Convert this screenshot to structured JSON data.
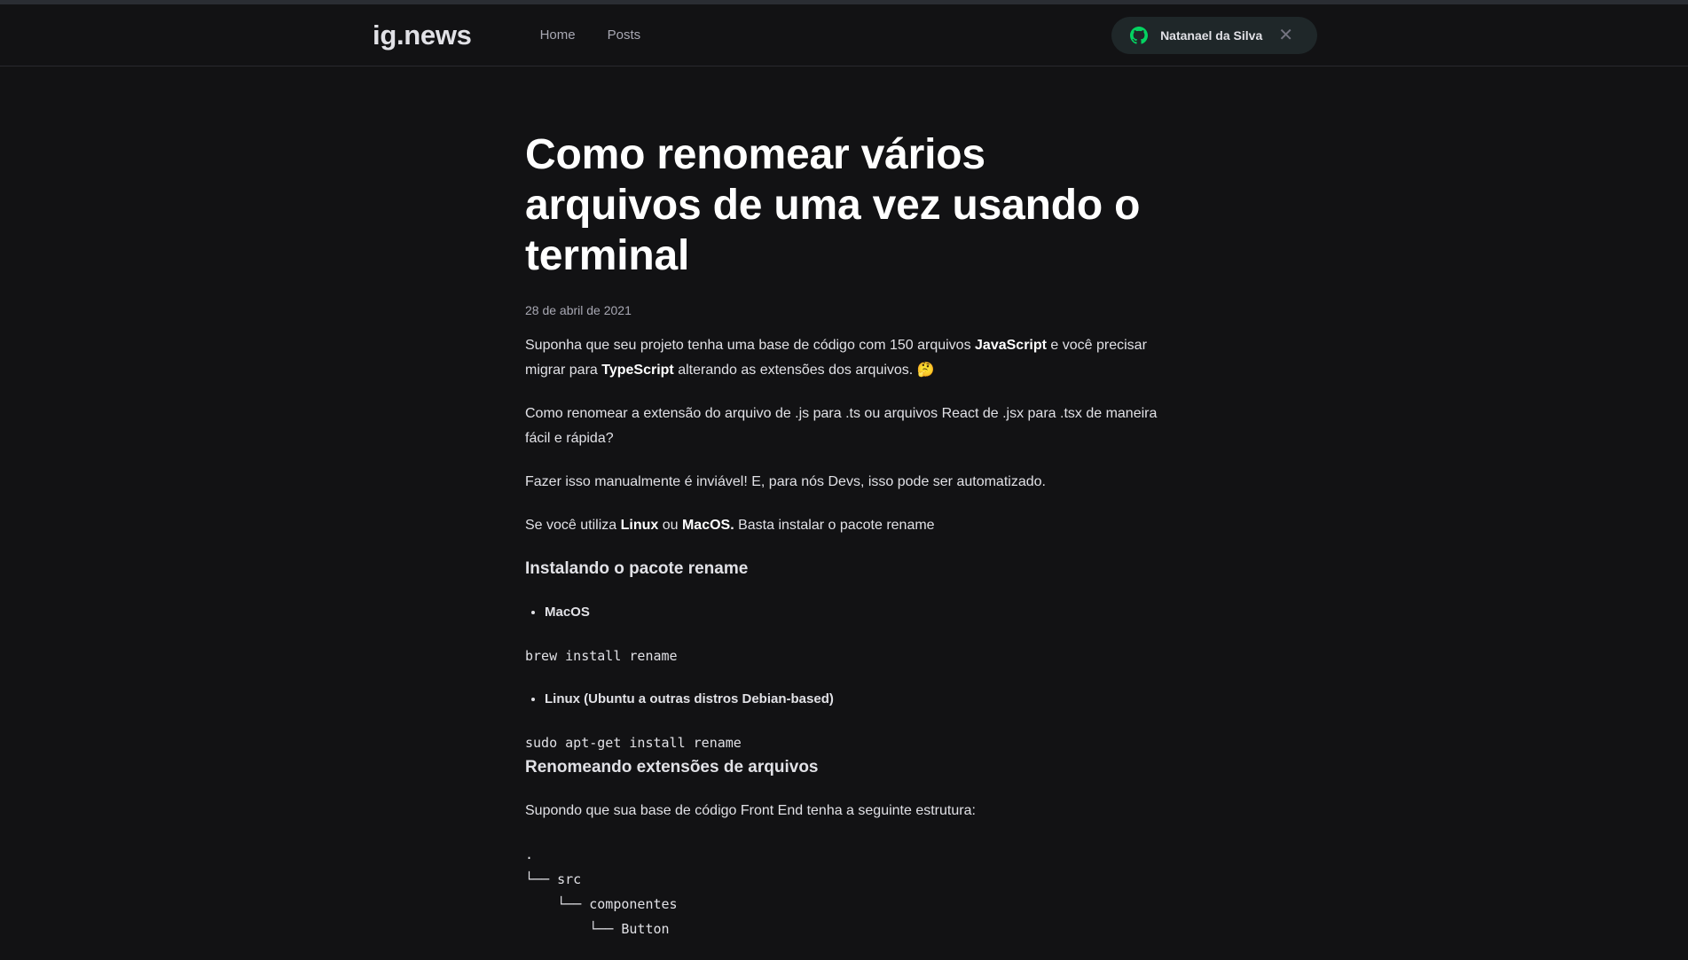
{
  "header": {
    "logo": "ig.news",
    "nav": [
      "Home",
      "Posts"
    ],
    "user_name": "Natanael da Silva",
    "close_symbol": "✕",
    "icons": {
      "github": "github-icon",
      "close": "close-icon"
    },
    "accent_color": "#04d361"
  },
  "post": {
    "title": "Como renomear vários arquivos de uma vez usando o terminal",
    "date": "28 de abril de 2021",
    "p1": {
      "a": "Suponha que seu projeto tenha uma base de código com 150 arquivos ",
      "b": "JavaScript",
      "c": " e você precisar migrar para ",
      "d": "TypeScript",
      "e": " alterando as extensões dos arquivos. 🤔"
    },
    "p2": "Como renomear a extensão do arquivo de .js para .ts ou arquivos React de .jsx para .tsx de maneira fácil e rápida?",
    "p3": "Fazer isso manualmente é inviável! E, para nós Devs, isso pode ser automatizado.",
    "p4": {
      "a": "Se você utiliza ",
      "b": "Linux",
      "c": " ou ",
      "d": "MacOS.",
      "e": " Basta instalar o pacote rename"
    },
    "h_install": "Instalando o pacote rename",
    "li_macos": "MacOS",
    "code_macos": "brew install rename",
    "li_linux": "Linux (Ubuntu a outras distros Debian-based)",
    "code_linux": "sudo apt-get install rename",
    "h_rename": "Renomeando extensões de arquivos",
    "p5": "Supondo que sua base de código Front End tenha a seguinte estrutura:",
    "tree": ".\n└── src\n    └── componentes\n        └── Button"
  }
}
